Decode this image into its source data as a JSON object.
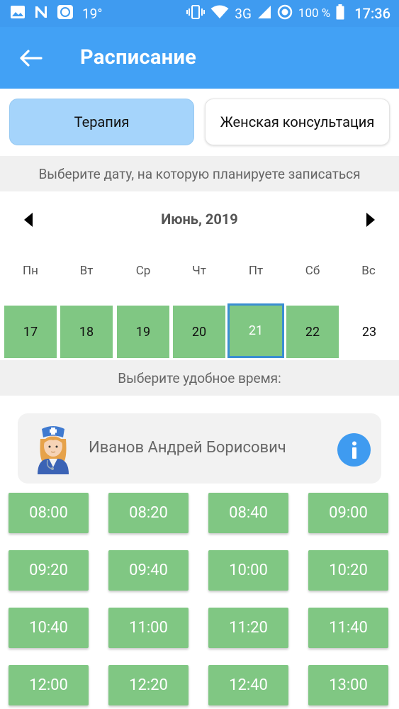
{
  "status_bar": {
    "temperature": "19°",
    "network": "3G",
    "battery_percent": "100 %",
    "time": "17:36"
  },
  "app_bar": {
    "title": "Расписание"
  },
  "tabs": [
    {
      "label": "Терапия",
      "active": true
    },
    {
      "label": "Женская консультация",
      "active": false
    }
  ],
  "date_hint": "Выберите дату, на которую планируете записаться",
  "calendar": {
    "month_label": "Июнь, 2019",
    "weekdays": [
      "Пн",
      "Вт",
      "Ср",
      "Чт",
      "Пт",
      "Сб",
      "Вс"
    ],
    "days": [
      {
        "label": "17",
        "available": true,
        "selected": false
      },
      {
        "label": "18",
        "available": true,
        "selected": false
      },
      {
        "label": "19",
        "available": true,
        "selected": false
      },
      {
        "label": "20",
        "available": true,
        "selected": false
      },
      {
        "label": "21",
        "available": true,
        "selected": true
      },
      {
        "label": "22",
        "available": true,
        "selected": false
      },
      {
        "label": "23",
        "available": false,
        "selected": false
      }
    ]
  },
  "time_hint": "Выберите удобное время:",
  "doctor": {
    "name": "Иванов Андрей Борисович"
  },
  "time_slots": [
    "08:00",
    "08:20",
    "08:40",
    "09:00",
    "09:20",
    "09:40",
    "10:00",
    "10:20",
    "10:40",
    "11:00",
    "11:20",
    "11:40",
    "12:00",
    "12:20",
    "12:40",
    "13:00"
  ],
  "colors": {
    "primary": "#42a1f5",
    "status_bar": "#3f9bf0",
    "tab_active": "#a5d4fb",
    "available_green": "#80c783",
    "selected_border": "#3a8ed1",
    "hint_bg": "#f0f0f0"
  }
}
